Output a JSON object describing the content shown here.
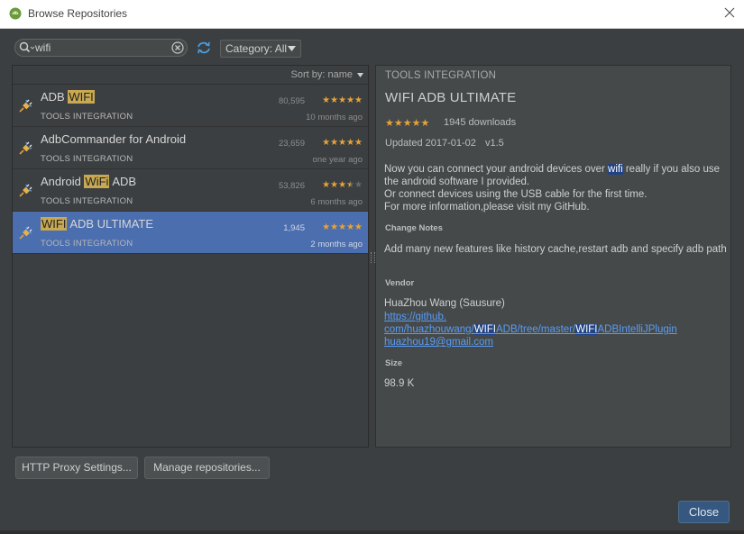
{
  "window": {
    "title": "Browse Repositories"
  },
  "search": {
    "value": "wifi"
  },
  "category": {
    "label": "Category: All"
  },
  "list": {
    "sort_label": "Sort by: name",
    "plugins": [
      {
        "name_parts": [
          "ADB ",
          "WIFI",
          ""
        ],
        "category": "TOOLS INTEGRATION",
        "downloads": "80,595",
        "rating": 5,
        "date": "10 months ago",
        "selected": false
      },
      {
        "name_parts": [
          "AdbCommander for Android",
          "",
          ""
        ],
        "category": "TOOLS INTEGRATION",
        "downloads": "23,659",
        "rating": 5,
        "date": "one year ago",
        "selected": false
      },
      {
        "name_parts": [
          "Android ",
          "WiFi",
          " ADB"
        ],
        "category": "TOOLS INTEGRATION",
        "downloads": "53,826",
        "rating": 3.5,
        "date": "6 months ago",
        "selected": false
      },
      {
        "name_parts": [
          "",
          "WIFI",
          " ADB ULTIMATE"
        ],
        "category": "TOOLS INTEGRATION",
        "downloads": "1,945",
        "rating": 5,
        "date": "2 months ago",
        "selected": true
      }
    ]
  },
  "detail": {
    "category": "TOOLS INTEGRATION",
    "title": "WIFI ADB ULTIMATE",
    "rating": 5,
    "downloads": "1945 downloads",
    "updated": "Updated 2017-01-02",
    "version": "v1.5",
    "desc_before": "Now you can connect your android devices over ",
    "desc_highlight": "wifi",
    "desc_after": " really if you also use the android software I provided.",
    "desc_line2": "Or connect devices using the USB cable for the first time.",
    "desc_line3": "For more information,please visit my GitHub.",
    "change_notes_heading": "Change Notes",
    "change_notes": "Add many new features like history cache,restart adb and specify adb path",
    "vendor_heading": "Vendor",
    "vendor_name": "HuaZhou Wang   (Sausure)",
    "link_line1": "https://github.",
    "link_line2_a": "com/huazhouwang/",
    "link_line2_hl1": "WIFI",
    "link_line2_b": "ADB/tree/master/",
    "link_line2_hl2": "WIFI",
    "link_line2_c": "ADBIntelliJPlugin",
    "email": "huazhou19@gmail.com",
    "size_heading": "Size",
    "size": "98.9 K"
  },
  "buttons": {
    "http_proxy": "HTTP Proxy Settings...",
    "manage_repos": "Manage repositories...",
    "close": "Close"
  },
  "icons": {
    "app": "android-icon",
    "search": "search-icon",
    "clear": "clear-icon",
    "refresh": "refresh-icon",
    "plugin": "plugin-plug-icon",
    "close": "close-icon"
  },
  "colors": {
    "accent": "#4b6eaf",
    "highlight": "#c8a952",
    "star": "#e6a33a",
    "link": "#589df6",
    "primary_button": "#365880"
  }
}
